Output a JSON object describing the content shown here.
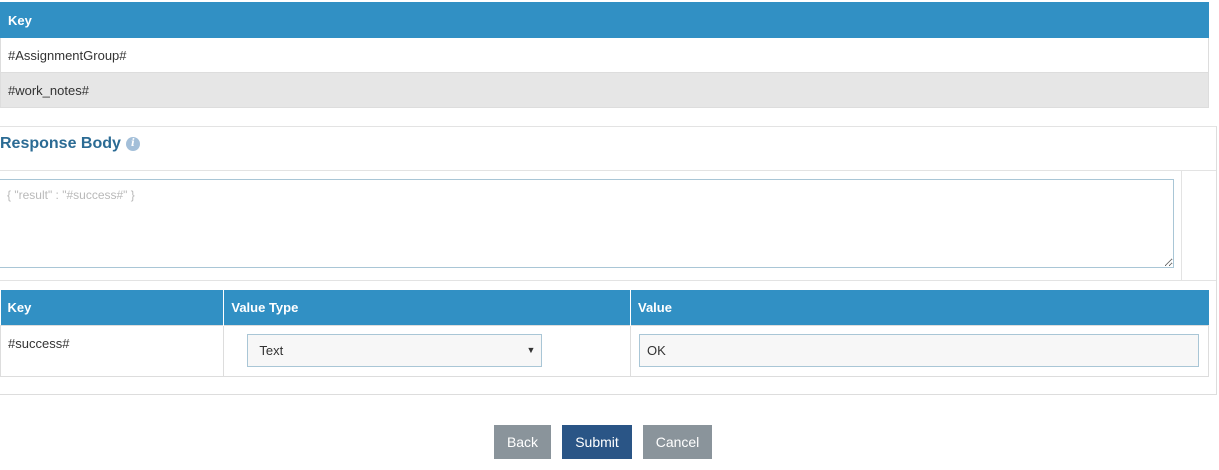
{
  "key_table": {
    "header": "Key",
    "rows": [
      "#AssignmentGroup#",
      "#work_notes#"
    ]
  },
  "response_body": {
    "title": "Response Body",
    "info_icon": "info-icon",
    "textarea_placeholder": "{ \"result\" : \"#success#\" }",
    "textarea_value": ""
  },
  "kv_table": {
    "headers": [
      "Key",
      "Value Type",
      "Value"
    ],
    "rows": [
      {
        "key": "#success#",
        "value_type": "Text",
        "value": "OK"
      }
    ]
  },
  "buttons": {
    "back": "Back",
    "submit": "Submit",
    "cancel": "Cancel"
  },
  "colors": {
    "table_header": "#3190c4",
    "section_title": "#2b6b94",
    "submit_button": "#2a5586",
    "secondary_button": "#8a949b"
  }
}
